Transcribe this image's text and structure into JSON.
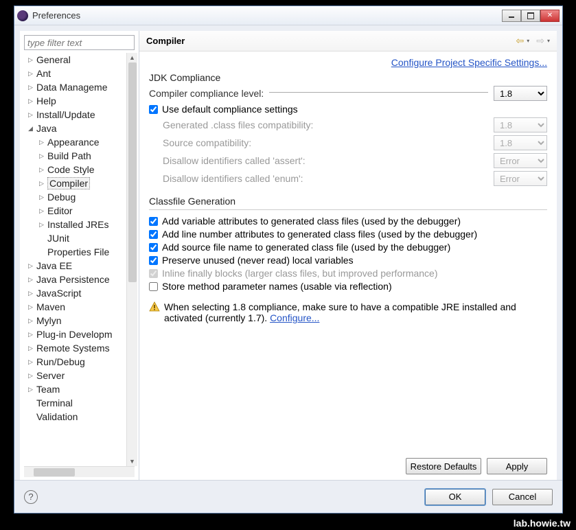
{
  "window": {
    "title": "Preferences"
  },
  "filter": {
    "placeholder": "type filter text"
  },
  "tree": [
    {
      "label": "General",
      "depth": 0,
      "exp": false,
      "hasChildren": true
    },
    {
      "label": "Ant",
      "depth": 0,
      "exp": false,
      "hasChildren": true
    },
    {
      "label": "Data Manageme",
      "depth": 0,
      "exp": false,
      "hasChildren": true
    },
    {
      "label": "Help",
      "depth": 0,
      "exp": false,
      "hasChildren": true
    },
    {
      "label": "Install/Update",
      "depth": 0,
      "exp": false,
      "hasChildren": true
    },
    {
      "label": "Java",
      "depth": 0,
      "exp": true,
      "hasChildren": true
    },
    {
      "label": "Appearance",
      "depth": 1,
      "exp": false,
      "hasChildren": true
    },
    {
      "label": "Build Path",
      "depth": 1,
      "exp": false,
      "hasChildren": true
    },
    {
      "label": "Code Style",
      "depth": 1,
      "exp": false,
      "hasChildren": true
    },
    {
      "label": "Compiler",
      "depth": 1,
      "exp": false,
      "hasChildren": true,
      "selected": true
    },
    {
      "label": "Debug",
      "depth": 1,
      "exp": false,
      "hasChildren": true
    },
    {
      "label": "Editor",
      "depth": 1,
      "exp": false,
      "hasChildren": true
    },
    {
      "label": "Installed JREs",
      "depth": 1,
      "exp": false,
      "hasChildren": true
    },
    {
      "label": "JUnit",
      "depth": 1,
      "exp": false,
      "hasChildren": false
    },
    {
      "label": "Properties File",
      "depth": 1,
      "exp": false,
      "hasChildren": false
    },
    {
      "label": "Java EE",
      "depth": 0,
      "exp": false,
      "hasChildren": true
    },
    {
      "label": "Java Persistence",
      "depth": 0,
      "exp": false,
      "hasChildren": true
    },
    {
      "label": "JavaScript",
      "depth": 0,
      "exp": false,
      "hasChildren": true
    },
    {
      "label": "Maven",
      "depth": 0,
      "exp": false,
      "hasChildren": true
    },
    {
      "label": "Mylyn",
      "depth": 0,
      "exp": false,
      "hasChildren": true
    },
    {
      "label": "Plug-in Developm",
      "depth": 0,
      "exp": false,
      "hasChildren": true
    },
    {
      "label": "Remote Systems",
      "depth": 0,
      "exp": false,
      "hasChildren": true
    },
    {
      "label": "Run/Debug",
      "depth": 0,
      "exp": false,
      "hasChildren": true
    },
    {
      "label": "Server",
      "depth": 0,
      "exp": false,
      "hasChildren": true
    },
    {
      "label": "Team",
      "depth": 0,
      "exp": false,
      "hasChildren": true
    },
    {
      "label": "Terminal",
      "depth": 0,
      "exp": false,
      "hasChildren": false
    },
    {
      "label": "Validation",
      "depth": 0,
      "exp": false,
      "hasChildren": false
    }
  ],
  "main": {
    "title": "Compiler",
    "projectLink": "Configure Project Specific Settings...",
    "jdk": {
      "groupTitle": "JDK Compliance",
      "complianceLabel": "Compiler compliance level:",
      "complianceValue": "1.8",
      "useDefaultLabel": "Use default compliance settings",
      "useDefaultChecked": true,
      "rows": [
        {
          "label": "Generated .class files compatibility:",
          "value": "1.8"
        },
        {
          "label": "Source compatibility:",
          "value": "1.8"
        },
        {
          "label": "Disallow identifiers called 'assert':",
          "value": "Error"
        },
        {
          "label": "Disallow identifiers called 'enum':",
          "value": "Error"
        }
      ]
    },
    "classfile": {
      "groupTitle": "Classfile Generation",
      "checks": [
        {
          "label": "Add variable attributes to generated class files (used by the debugger)",
          "checked": true,
          "disabled": false
        },
        {
          "label": "Add line number attributes to generated class files (used by the debugger)",
          "checked": true,
          "disabled": false
        },
        {
          "label": "Add source file name to generated class file (used by the debugger)",
          "checked": true,
          "disabled": false
        },
        {
          "label": "Preserve unused (never read) local variables",
          "checked": true,
          "disabled": false
        },
        {
          "label": "Inline finally blocks (larger class files, but improved performance)",
          "checked": true,
          "disabled": true
        },
        {
          "label": "Store method parameter names (usable via reflection)",
          "checked": false,
          "disabled": false
        }
      ]
    },
    "warning": {
      "text1": "When selecting 1.8 compliance, make sure to have a compatible JRE installed and activated (currently 1.7). ",
      "link": "Configure..."
    },
    "buttons": {
      "restore": "Restore Defaults",
      "apply": "Apply"
    }
  },
  "footer": {
    "ok": "OK",
    "cancel": "Cancel"
  },
  "watermark": "lab.howie.tw"
}
